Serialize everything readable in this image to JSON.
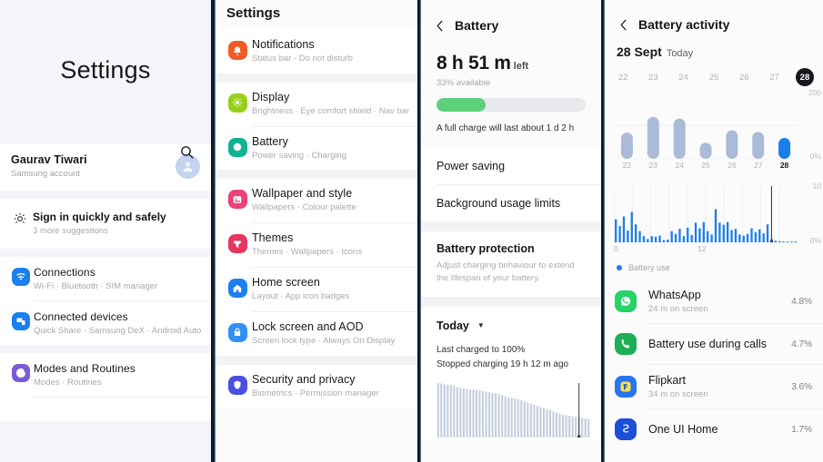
{
  "home": {
    "title": "Settings",
    "search_icon": "search-icon",
    "account": {
      "name": "Gaurav Tiwari",
      "sub": "Samsung account",
      "avatar_icon": "person-icon"
    },
    "suggestion": {
      "icon": "lightbulb-icon",
      "title": "Sign in quickly and safely",
      "sub": "3 more suggestions"
    },
    "items": [
      {
        "title": "Connections",
        "sub": "Wi-Fi  ·  Bluetooth  ·  SIM manager",
        "icon": "wifi-icon",
        "color": "#1b7ff0"
      },
      {
        "title": "Connected devices",
        "sub": "Quick Share  ·  Samsung DeX  ·  Android Auto",
        "icon": "devices-icon",
        "color": "#1b7ff0"
      },
      {
        "title": "Modes and Routines",
        "sub": "Modes  ·  Routines",
        "icon": "check-circle-icon",
        "color": "#7a5bd6"
      }
    ]
  },
  "settings_list": {
    "title": "Settings",
    "groups": [
      {
        "items": [
          {
            "title": "Notifications",
            "sub": "Status bar  ·  Do not disturb",
            "icon": "notification-icon",
            "color": "#f15a24"
          }
        ]
      },
      {
        "items": [
          {
            "title": "Display",
            "sub": "Brightness  ·  Eye comfort shield  ·  Nav bar",
            "icon": "brightness-icon",
            "color": "#97cf1a"
          },
          {
            "title": "Battery",
            "sub": "Power saving  ·  Charging",
            "icon": "battery-icon",
            "color": "#0fb391"
          }
        ]
      },
      {
        "items": [
          {
            "title": "Wallpaper and style",
            "sub": "Wallpapers  ·  Colour palette",
            "icon": "image-icon",
            "color": "#ec4079"
          },
          {
            "title": "Themes",
            "sub": "Themes  ·  Wallpapers  ·  Icons",
            "icon": "brush-icon",
            "color": "#e8355f"
          },
          {
            "title": "Home screen",
            "sub": "Layout  ·  App icon badges",
            "icon": "house-icon",
            "color": "#1b7ff0"
          },
          {
            "title": "Lock screen and AOD",
            "sub": "Screen lock type  ·  Always On Display",
            "icon": "lock-icon",
            "color": "#3190f3"
          }
        ]
      },
      {
        "items": [
          {
            "title": "Security and privacy",
            "sub": "Biometrics  ·  Permission manager",
            "icon": "shield-icon",
            "color": "#4a4fe3"
          }
        ]
      }
    ]
  },
  "battery": {
    "back_icon": "chevron-left-icon",
    "title": "Battery",
    "time_left": "8 h 51 m",
    "time_left_unit": "left",
    "available": "33% available",
    "percent": 33,
    "bar_color": "#5ed07c",
    "full_charge_note": "A full charge will last about 1 d 2 h",
    "menu": [
      "Power saving",
      "Background usage limits"
    ],
    "protection": {
      "title": "Battery protection",
      "sub": "Adjust charging behaviour to extend the lifespan of your battery."
    },
    "today_label": "Today",
    "today_caret": "chevron-down-icon",
    "last_charged": "Last charged to 100%",
    "stopped_charging": "Stopped charging 19 h 12 m ago",
    "chart_data": {
      "type": "area",
      "title": "Battery level today",
      "xlabel": "",
      "ylabel": "",
      "ylim": [
        0,
        100
      ],
      "x": [
        0,
        1,
        2,
        3,
        4,
        5,
        6,
        7,
        8,
        9,
        10,
        11,
        12,
        13,
        14,
        15,
        16,
        17,
        18,
        19,
        20,
        21,
        22,
        23,
        24,
        25,
        26,
        27,
        28,
        29,
        30,
        31,
        32,
        33,
        34,
        35,
        36,
        37,
        38,
        39,
        40,
        41,
        42,
        43,
        44,
        45,
        46,
        47
      ],
      "values": [
        100,
        99,
        98,
        97,
        96,
        95,
        93,
        91,
        90,
        89,
        88,
        88,
        87,
        86,
        85,
        84,
        83,
        82,
        81,
        80,
        78,
        76,
        74,
        73,
        72,
        70,
        68,
        66,
        64,
        62,
        60,
        58,
        56,
        54,
        52,
        50,
        48,
        46,
        44,
        42,
        41,
        40,
        39,
        38,
        37,
        36,
        35,
        34
      ],
      "marker_index": 44,
      "grid": false
    }
  },
  "activity": {
    "back_icon": "chevron-left-icon",
    "title": "Battery activity",
    "date": "28 Sept",
    "date_sub": "Today",
    "day_chips": [
      "22",
      "23",
      "24",
      "25",
      "26",
      "27",
      "28"
    ],
    "selected_day": "28",
    "legend": {
      "label": "Battery use",
      "color": "#1a7ee8"
    },
    "chart_data": [
      {
        "type": "bar",
        "title": "Daily screen time",
        "categories": [
          "22",
          "23",
          "24",
          "25",
          "26",
          "27",
          "28"
        ],
        "values": [
          78,
          125,
          120,
          48,
          85,
          80,
          62
        ],
        "ylim": [
          0,
          200
        ],
        "ytick_labels": [
          "200",
          "0%"
        ],
        "xlabel": "",
        "ylabel": "",
        "bar_color": "#aabbd8",
        "highlight_color": "#1a7ee8",
        "highlight_index": 6,
        "grid": true
      },
      {
        "type": "bar",
        "title": "Hourly battery use",
        "categories": [
          "0",
          "1",
          "2",
          "3",
          "4",
          "5",
          "6",
          "7",
          "8",
          "9",
          "10",
          "11",
          "12",
          "13",
          "14",
          "15",
          "16",
          "17",
          "18",
          "19",
          "20",
          "21",
          "22",
          "23",
          "24",
          "25",
          "26",
          "27",
          "28",
          "29",
          "30",
          "31",
          "32",
          "33",
          "34",
          "35",
          "36",
          "37",
          "38",
          "39",
          "40",
          "41",
          "42",
          "43",
          "44",
          "45"
        ],
        "values": [
          4.1,
          2.9,
          4.6,
          2.1,
          5.4,
          3.2,
          2.0,
          1.1,
          0.6,
          1.1,
          1.0,
          1.2,
          0.4,
          0.5,
          2.0,
          1.5,
          2.4,
          1.1,
          2.6,
          1.3,
          3.5,
          2.5,
          3.6,
          2.0,
          1.4,
          5.9,
          3.5,
          3.1,
          3.6,
          2.2,
          2.4,
          1.4,
          1.2,
          1.5,
          2.5,
          1.8,
          2.3,
          1.6,
          3.2,
          0.6,
          0.3,
          0.2,
          0.1,
          0.1,
          0.1,
          0.1
        ],
        "ylim": [
          0,
          10
        ],
        "ytick_labels": [
          "10",
          "0%"
        ],
        "xtick_labels": [
          "0",
          "12"
        ],
        "bar_color": "#1a7ee8",
        "now_marker_index": 39,
        "xlabel": "",
        "ylabel": "",
        "grid": true
      }
    ],
    "apps": [
      {
        "name": "WhatsApp",
        "sub": "24 m on screen",
        "pct": "4.8%",
        "icon": "whatsapp-icon",
        "color": "#25D366"
      },
      {
        "name": "Battery use during calls",
        "sub": "",
        "pct": "4.7%",
        "icon": "phone-icon",
        "color": "#1eae56"
      },
      {
        "name": "Flipkart",
        "sub": "34 m on screen",
        "pct": "3.6%",
        "icon": "flipkart-icon",
        "color": "#2874f0"
      },
      {
        "name": "One UI Home",
        "sub": "",
        "pct": "1.7%",
        "icon": "oneui-home-icon",
        "color": "#1b4fd8"
      }
    ]
  }
}
